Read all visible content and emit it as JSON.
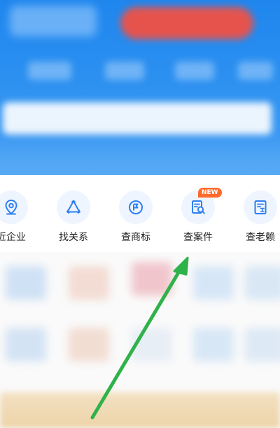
{
  "menu": {
    "items": [
      {
        "label": "近企业",
        "icon": "map-pin-icon"
      },
      {
        "label": "找关系",
        "icon": "relation-triangle-icon"
      },
      {
        "label": "查商标",
        "icon": "trademark-icon"
      },
      {
        "label": "查案件",
        "icon": "case-search-icon",
        "badge": "NEW"
      },
      {
        "label": "查老赖",
        "icon": "debtor-doc-icon"
      }
    ]
  },
  "colors": {
    "header_blue": "#2a8ff0",
    "icon_blue": "#2f7ff0",
    "badge_orange": "#ff6a2a",
    "arrow_green": "#2fb24a"
  }
}
